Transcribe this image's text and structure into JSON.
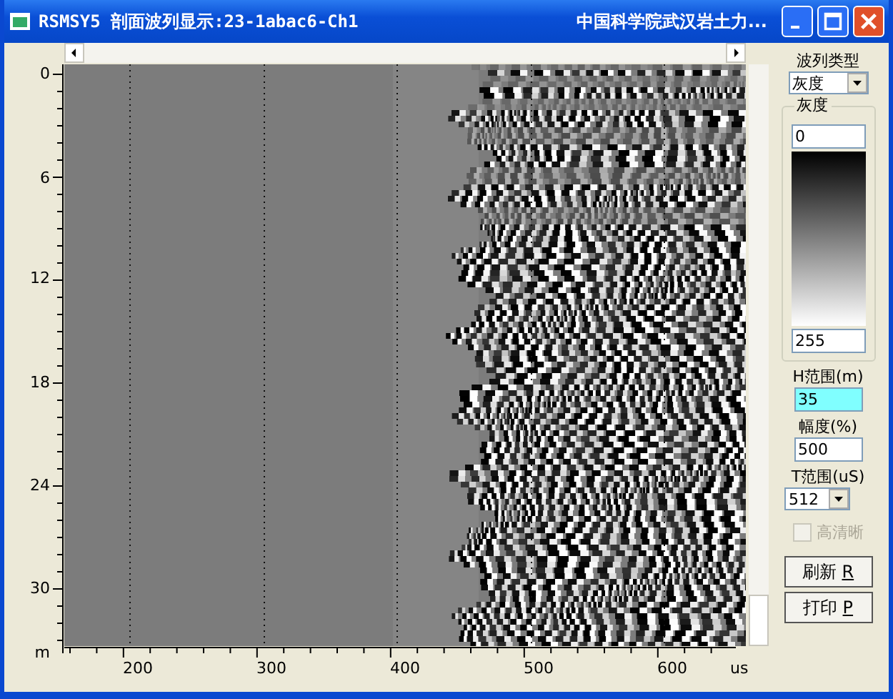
{
  "window": {
    "title": "RSMSY5 剖面波列显示:23-1abac6-Ch1",
    "title_right": "中国科学院武汉岩土力..."
  },
  "y_axis": {
    "labels": [
      "0",
      "6",
      "12",
      "18",
      "24",
      "30"
    ],
    "unit": "m"
  },
  "x_axis": {
    "labels": [
      "200",
      "300",
      "400",
      "500",
      "600"
    ],
    "unit": "us"
  },
  "panel": {
    "wave_type_label": "波列类型",
    "wave_type": "灰度",
    "gray_group": {
      "title": "灰度",
      "min": "0",
      "max": "255"
    },
    "h_range": {
      "label": "H范围(m)",
      "value": "35",
      "selected": true
    },
    "amplitude": {
      "label": "幅度(%)",
      "value": "500",
      "selected": false
    },
    "t_range": {
      "label": "T范围(uS)",
      "value": "512"
    },
    "hd": {
      "label": "高清晰",
      "checked": false,
      "disabled": true
    },
    "buttons": [
      {
        "label": "刷新",
        "key": "R"
      },
      {
        "label": "打印",
        "key": "P"
      }
    ]
  }
}
